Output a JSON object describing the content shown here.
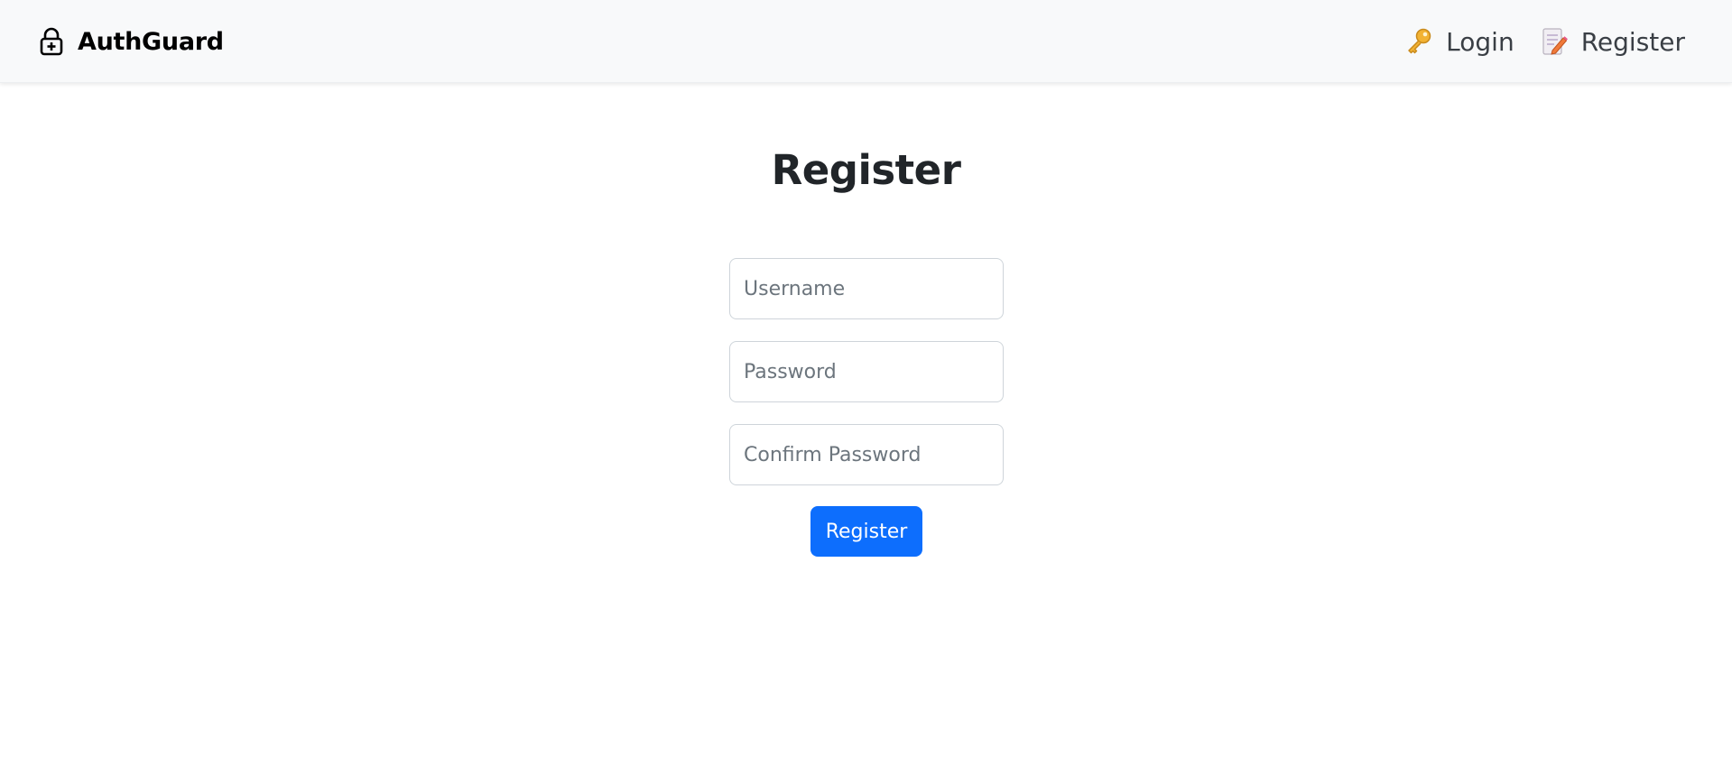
{
  "navbar": {
    "brand": "AuthGuard",
    "brand_icon": "lock-icon",
    "links": [
      {
        "label": "Login",
        "icon": "key-icon"
      },
      {
        "label": "Register",
        "icon": "memo-icon"
      }
    ]
  },
  "page": {
    "title": "Register"
  },
  "form": {
    "username_placeholder": "Username",
    "password_placeholder": "Password",
    "confirm_placeholder": "Confirm Password",
    "submit_label": "Register"
  },
  "colors": {
    "primary": "#0d6efd",
    "navbar_bg": "#f8f9fa",
    "text": "#212529"
  }
}
